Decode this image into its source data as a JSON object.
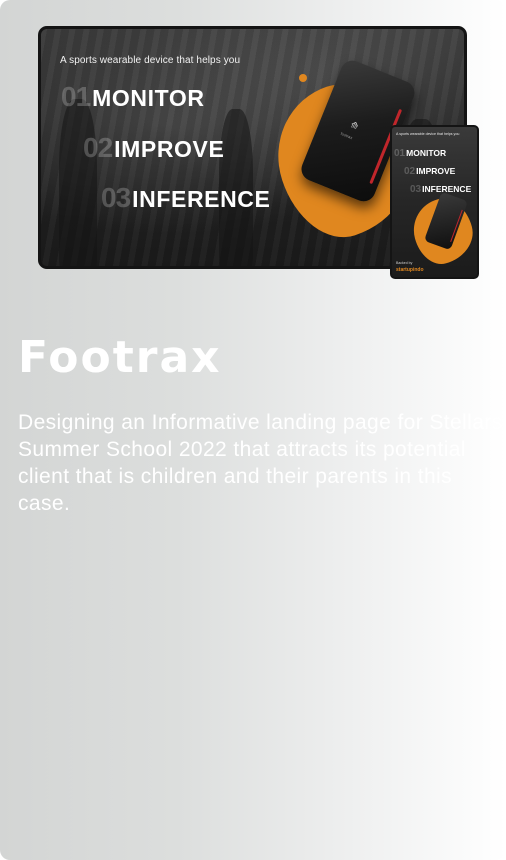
{
  "project": {
    "title": "Footrax",
    "description": "Designing an Informative landing page for Stellars Summer School 2022 that attracts its potential client that is children and their parents in this case."
  },
  "desktop_mockup": {
    "tagline": "A sports wearable device that helps you",
    "steps": [
      {
        "num": "01",
        "word": "MONITOR"
      },
      {
        "num": "02",
        "word": "IMPROVE"
      },
      {
        "num": "03",
        "word": "INFERENCE"
      }
    ],
    "device_brand": "footrax"
  },
  "phone_mockup": {
    "tagline": "A sports wearable device that helps you",
    "steps": [
      {
        "num": "01",
        "word": "MONITOR"
      },
      {
        "num": "02",
        "word": "IMPROVE"
      },
      {
        "num": "03",
        "word": "INFERENCE"
      }
    ],
    "backed_by": "Backed by",
    "sponsor": "startupindo"
  },
  "colors": {
    "accent_orange": "#e0871f",
    "device_red": "#c0262b",
    "frame": "#141414"
  },
  "icons": {
    "device_logo": "footrax-logo-icon"
  }
}
